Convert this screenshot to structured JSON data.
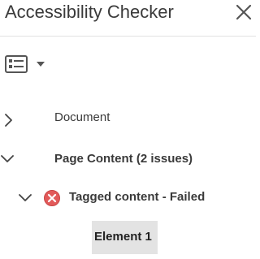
{
  "panel": {
    "title": "Accessibility Checker",
    "close_icon": "close-icon",
    "options_icon": "list-options-icon",
    "options_menu_icon": "chevron-down-icon"
  },
  "tree": {
    "document": {
      "label": "Document",
      "expanded": false,
      "icon": "chevron-right-icon"
    },
    "page_content": {
      "label": "Page Content (2 issues)",
      "expanded": true,
      "icon": "chevron-down-icon"
    },
    "tagged_content": {
      "label": "Tagged content - Failed",
      "expanded": true,
      "icon": "chevron-down-icon",
      "status_icon": "failed-icon",
      "status_color": "#e25a5a"
    },
    "element": {
      "label": "Element 1",
      "selected": true
    }
  }
}
